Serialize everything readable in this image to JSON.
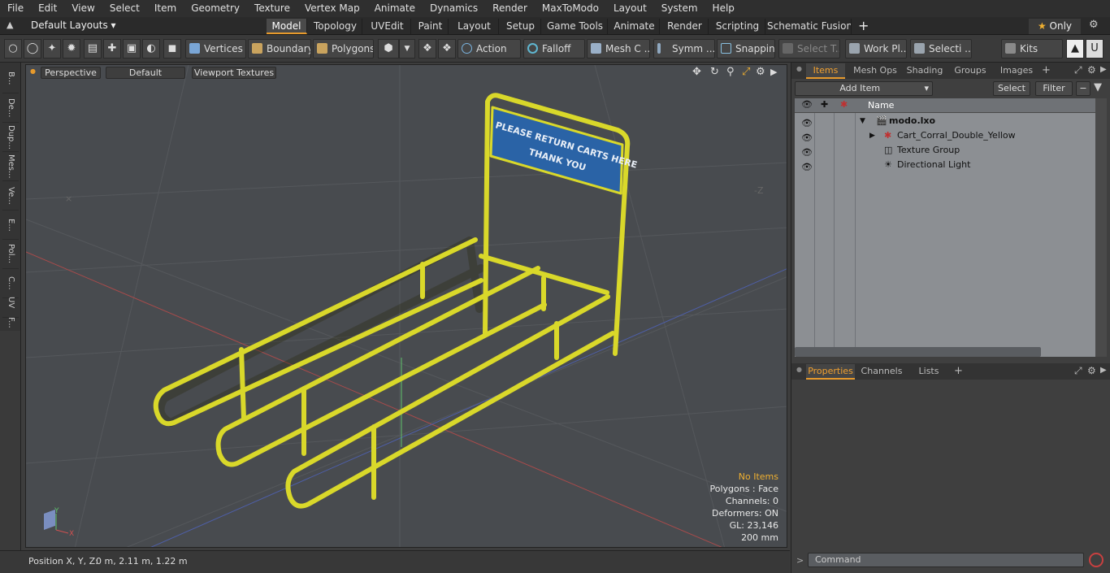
{
  "menubar": {
    "items": [
      "File",
      "Edit",
      "View",
      "Select",
      "Item",
      "Geometry",
      "Texture",
      "Vertex Map",
      "Animate",
      "Dynamics",
      "Render",
      "MaxToModo",
      "Layout",
      "System",
      "Help"
    ]
  },
  "layout_selector": "Default Layouts",
  "layout_tabs": [
    "Model",
    "Topology",
    "UVEdit",
    "Paint",
    "Layout",
    "Setup",
    "Game Tools",
    "Animate",
    "Render",
    "Scripting",
    "Schematic Fusion"
  ],
  "only_label": "Only",
  "toolbar": {
    "vertices": "Vertices",
    "boundary": "Boundary",
    "polygons": "Polygons",
    "action": "Action",
    "falloff": "Falloff",
    "mesh": "Mesh C ...",
    "symm": "Symm ...",
    "snapping": "Snapping",
    "select_t": "Select T...",
    "workpl": "Work Pl...",
    "selecti": "Selecti ...",
    "kits": "Kits"
  },
  "left_tabs": [
    "B...",
    "De...",
    "Dup...",
    "Mes...",
    "Ve...",
    "E...",
    "Pol...",
    "C...",
    "UV",
    "F..."
  ],
  "viewport": {
    "view_mode": "Perspective",
    "shading": "Default",
    "textures": "Viewport Textures",
    "sign_line1": "PLEASE RETURN CARTS HERE",
    "sign_line2": "THANK YOU",
    "info": {
      "items": "No Items",
      "polygons": "Polygons : Face",
      "channels": "Channels: 0",
      "deformers": "Deformers: ON",
      "gl": "GL: 23,146",
      "scale": "200 mm"
    },
    "axis_x": "X",
    "axis_y": "Y"
  },
  "status": {
    "position_label": "Position X, Y, Z:",
    "position_value": "0 m, 2.11 m, 1.22 m"
  },
  "items_panel": {
    "tabs": [
      "Items",
      "Mesh Ops",
      "Shading",
      "Groups",
      "Images"
    ],
    "add_item": "Add Item",
    "select": "Select",
    "filter": "Filter",
    "name_header": "Name",
    "rows": [
      "modo.lxo",
      "Cart_Corral_Double_Yellow",
      "Texture Group",
      "Directional Light"
    ]
  },
  "properties_panel": {
    "tabs": [
      "Properties",
      "Channels",
      "Lists"
    ]
  },
  "command_placeholder": "Command",
  "colors": {
    "accent": "#e79a2c",
    "frame_yellow": "#d9d82a",
    "sign_blue": "#2a63a6"
  }
}
